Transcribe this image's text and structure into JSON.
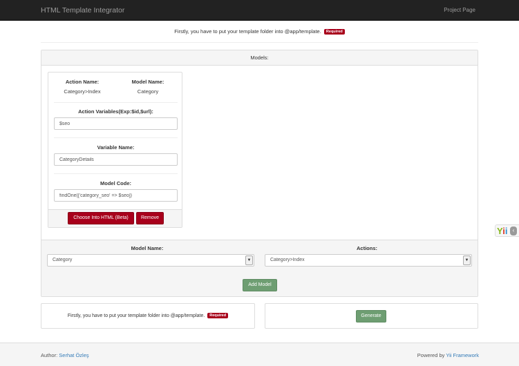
{
  "navbar": {
    "brand": "HTML Template Integrator",
    "project_page": "Project Page"
  },
  "notice": {
    "text": "Firstly, you have to put your template folder into @app/template.",
    "badge": "Required"
  },
  "models": {
    "heading": "Models:",
    "card": {
      "action_name_label": "Action Name:",
      "action_name_value": "Category>Index",
      "model_name_label": "Model Name:",
      "model_name_value": "Category",
      "action_variables_label": "Action Variables(Exp:$id,$url):",
      "action_variables_value": "$seo",
      "variable_name_label": "Variable Name:",
      "variable_name_value": "CategoryDetails",
      "model_code_label": "Model Code:",
      "model_code_value": "findOne(['category_seo' => $seo])",
      "choose_button": "Choose Into HTML (Beta)",
      "remove_button": "Remove"
    },
    "form": {
      "model_name_label": "Model Name:",
      "model_name_selected": "Category",
      "actions_label": "Actions:",
      "actions_selected": "Category>Index",
      "add_button": "Add Model"
    }
  },
  "bottom": {
    "notice_text": "Firstly, you have to put your template folder into @app/template.",
    "badge": "Required",
    "generate_button": "Generate"
  },
  "footer": {
    "author_label": "Author:",
    "author_name": "Serhat Özleş",
    "powered_label": "Powered by",
    "powered_link": "Yii Framework"
  },
  "colors": {
    "navbar_bg": "#222222",
    "danger": "#a8001b",
    "success": "#6e9e72",
    "link": "#337ab7"
  },
  "icons": {
    "debug_logo": "yii-logo-icon",
    "debug_toggle": "chevron-left-icon",
    "select_arrow": "chevron-down-icon"
  }
}
